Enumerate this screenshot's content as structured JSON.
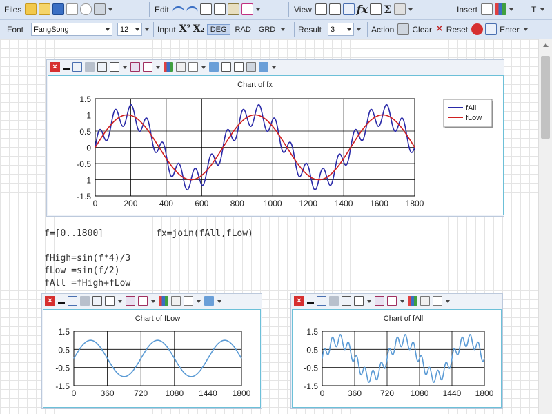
{
  "toolbar": {
    "files_label": "Files",
    "edit_label": "Edit",
    "view_label": "View",
    "insert_label": "Insert",
    "t_label": "T",
    "font_label": "Font",
    "font_value": "FangSong",
    "size_value": "12",
    "input_label": "Input",
    "superscript_glyph": "X²",
    "subscript_glyph": "X₂",
    "modes": [
      "DEG",
      "RAD",
      "GRD"
    ],
    "active_mode": "DEG",
    "result_label": "Result",
    "result_value": "3",
    "action_label": "Action",
    "clear_label": "Clear",
    "reset_label": "Reset",
    "enter_label": "Enter"
  },
  "code": {
    "line_range": "f=[0..1800]",
    "line_join": "fx=join(fAll,fLow)",
    "line_high": "fHigh=sin(f*4)/3",
    "line_low": "fLow =sin(f/2)",
    "line_all": "fAll =fHigh+fLow"
  },
  "chart_data": [
    {
      "type": "line",
      "title": "Chart of fx",
      "xlabel": "",
      "ylabel": "",
      "xlim": [
        0,
        1800
      ],
      "ylim": [
        -1.5,
        1.5
      ],
      "xticks": [
        0,
        200,
        400,
        600,
        800,
        1000,
        1200,
        1400,
        1600,
        1800
      ],
      "yticks": [
        -1.5,
        -1,
        -0.5,
        0,
        0.5,
        1,
        1.5
      ],
      "grid": true,
      "legend": "top-right",
      "series": [
        {
          "name": "fAll",
          "color": "#2a2aa8",
          "formula": "sin(x*4)/3 + sin(x/2)"
        },
        {
          "name": "fLow",
          "color": "#d02020",
          "formula": "sin(x/2)"
        }
      ]
    },
    {
      "type": "line",
      "title": "Chart of fLow",
      "xlabel": "",
      "ylabel": "",
      "xlim": [
        0,
        1800
      ],
      "ylim": [
        -1.5,
        1.5
      ],
      "xticks": [
        0,
        360,
        720,
        1080,
        1440,
        1800
      ],
      "yticks": [
        -1.5,
        -0.5,
        0.5,
        1.5
      ],
      "grid": true,
      "series": [
        {
          "color": "#5b9bd5",
          "formula": "sin(x/2)"
        }
      ]
    },
    {
      "type": "line",
      "title": "Chart of fAll",
      "xlabel": "",
      "ylabel": "",
      "xlim": [
        0,
        1800
      ],
      "ylim": [
        -1.5,
        1.5
      ],
      "xticks": [
        0,
        360,
        720,
        1080,
        1440,
        1800
      ],
      "yticks": [
        -1.5,
        -0.5,
        0.5,
        1.5
      ],
      "grid": true,
      "series": [
        {
          "color": "#5b9bd5",
          "formula": "sin(x*4)/3 + sin(x/2)"
        }
      ]
    }
  ]
}
